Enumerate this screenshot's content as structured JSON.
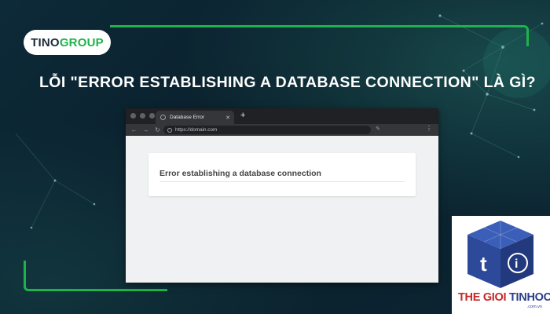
{
  "logo": {
    "part1": "TINO",
    "part2": "GROUP"
  },
  "headline": "LỖI \"ERROR ESTABLISHING A DATABASE CONNECTION\" LÀ GÌ?",
  "browser": {
    "tab_title": "Database Error",
    "tab_close": "✕",
    "new_tab": "+",
    "url": "https://domain.com",
    "error_message": "Error establishing a database connection"
  },
  "badge": {
    "name_part1": "THE GIOI",
    "name_part2": "TINHOC",
    "domain": ".com.vn"
  },
  "colors": {
    "accent_green": "#1db34a",
    "background": "#0b2330",
    "badge_red": "#c62828",
    "badge_blue": "#2d3e8c"
  }
}
